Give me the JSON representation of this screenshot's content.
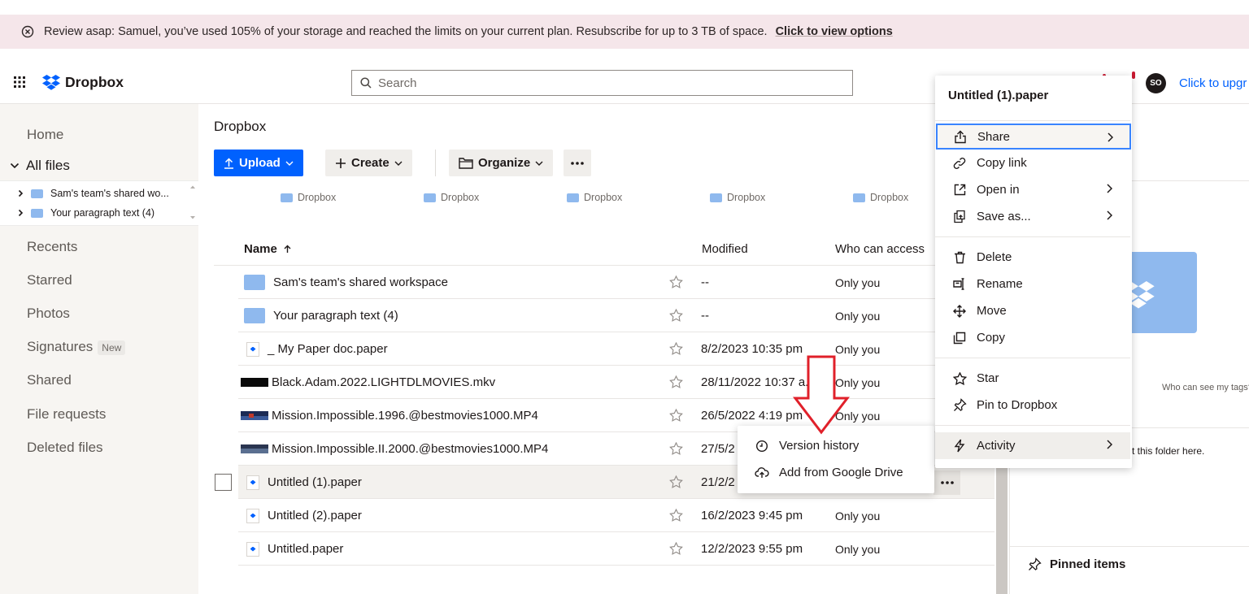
{
  "banner": {
    "text": "Review asap: Samuel, you’ve used 105% of your storage and reached the limits on your current plan. Resubscribe for up to 3 TB of space.",
    "link": "Click to view options"
  },
  "header": {
    "logo": "Dropbox",
    "search_placeholder": "Search",
    "avatar_initials": "SO",
    "upgrade_link": "Click to upgr"
  },
  "sidebar": {
    "home": "Home",
    "all_files": "All files",
    "tree": [
      "Sam's team's shared wo...",
      "Your paragraph text (4)"
    ],
    "recents": "Recents",
    "starred": "Starred",
    "photos": "Photos",
    "signatures": "Signatures",
    "signatures_badge": "New",
    "shared": "Shared",
    "file_requests": "File requests",
    "deleted_files": "Deleted files"
  },
  "main": {
    "breadcrumb": "Dropbox",
    "upload": "Upload",
    "create": "Create",
    "organize": "Organize",
    "suggested": [
      "Dropbox",
      "Dropbox",
      "Dropbox",
      "Dropbox",
      "Dropbox"
    ],
    "columns": {
      "name": "Name",
      "modified": "Modified",
      "access": "Who can access"
    },
    "rows": [
      {
        "name": "Sam's team's shared workspace",
        "modified": "--",
        "access": "Only you",
        "type": "folder"
      },
      {
        "name": "Your paragraph text (4)",
        "modified": "--",
        "access": "Only you",
        "type": "folder"
      },
      {
        "name": "_ My Paper doc.paper",
        "modified": "8/2/2023 10:35 pm",
        "access": "Only you",
        "type": "paper"
      },
      {
        "name": "Black.Adam.2022.LIGHTDLMOVIES.mkv",
        "modified": "28/11/2022 10:37 a...",
        "access": "Only you",
        "type": "video"
      },
      {
        "name": "Mission.Impossible.1996.@bestmovies1000.MP4",
        "modified": "26/5/2022 4:19 pm",
        "access": "Only you",
        "type": "video"
      },
      {
        "name": "Mission.Impossible.II.2000.@bestmovies1000.MP4",
        "modified": "27/5/2",
        "access": "",
        "type": "video"
      },
      {
        "name": "Untitled (1).paper",
        "modified": "21/2/2",
        "access": "",
        "type": "paper"
      },
      {
        "name": "Untitled (2).paper",
        "modified": "16/2/2023 9:45 pm",
        "access": "Only you",
        "type": "paper"
      },
      {
        "name": "Untitled.paper",
        "modified": "12/2/2023 9:55 pm",
        "access": "Only you",
        "type": "paper"
      }
    ]
  },
  "context_menu": {
    "title": "Untitled (1).paper",
    "items": [
      "Share",
      "Copy link",
      "Open in",
      "Save as...",
      "Delete",
      "Rename",
      "Move",
      "Copy",
      "Star",
      "Pin to Dropbox",
      "Activity"
    ]
  },
  "sub_menu": {
    "items": [
      "Version history",
      "Add from Google Drive"
    ]
  },
  "right_panel": {
    "tags_text": "Who can see my tags?",
    "folder_text": "t this folder here.",
    "pinned": "Pinned items"
  },
  "colors": {
    "accent": "#0061fe",
    "banner_bg": "#f5e6ea",
    "arrow": "#e0202a",
    "folder": "#8fb9ee"
  }
}
